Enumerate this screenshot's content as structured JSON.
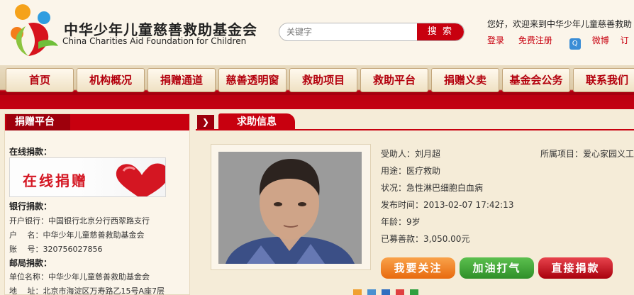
{
  "header": {
    "logo_cn": "中华少年儿童慈善救助基金会",
    "logo_en": "China Charities Aid Foundation for Children",
    "search_placeholder": "关键字",
    "search_button": "搜 索",
    "welcome": "您好，欢迎来到中华少年儿童慈善救助",
    "login": "登录",
    "register": "免费注册",
    "weibo": "微博",
    "extra": "订"
  },
  "nav": {
    "items": [
      "首页",
      "机构概况",
      "捐赠通道",
      "慈善透明窗",
      "救助项目",
      "救助平台",
      "捐赠义卖",
      "基金会公务",
      "联系我们"
    ]
  },
  "left": {
    "title": "捐赠平台",
    "online_label": "在线捐款：",
    "online_banner": "在线捐赠",
    "bank_label": "银行捐款：",
    "bank_rows": [
      "开户银行：中国银行北京分行西翠路支行",
      "户　 名：中华少年儿童慈善救助基金会",
      "账　 号：320756027856"
    ],
    "post_label": "邮局捐款：",
    "post_rows": [
      "单位名称：中华少年儿童慈善救助基金会",
      "地　 址：北京市海淀区万寿路乙15号A座7层"
    ]
  },
  "right": {
    "title": "求助信息",
    "info": [
      "受助人：刘月超",
      "用途：医疗救助",
      "状况：急性淋巴细胞白血病",
      "发布时间：2013-02-07 17:42:13",
      "年龄：9岁",
      "已募善款：3,050.00元"
    ],
    "project": "所属项目：爱心家园义工",
    "btn_follow": "我要关注",
    "btn_cheer": "加油打气",
    "btn_donate": "直接捐款"
  },
  "colors": {
    "brand_red": "#c8000f",
    "background": "#f5ecd8"
  }
}
